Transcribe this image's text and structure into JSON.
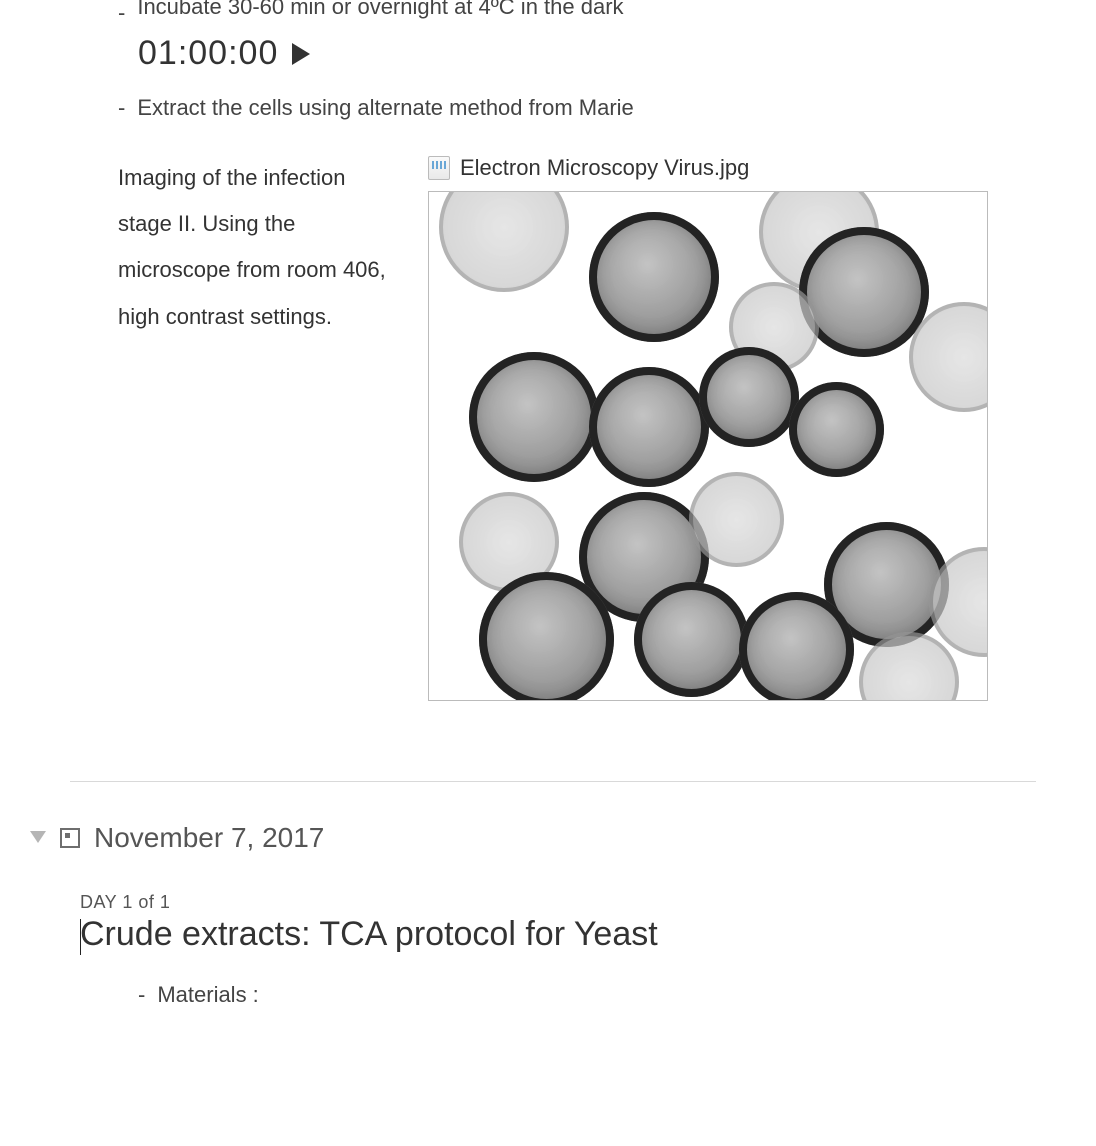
{
  "step_incubate": "Incubate 30-60 min or overnight at 4ºC in the dark",
  "timer": "01:00:00",
  "step_extract": "Extract the cells using alternate method from Marie",
  "caption": "Imaging of the infection stage II. Using the microscope from room 406, high contrast settings.",
  "attachment_filename": "Electron Microscopy Virus.jpg",
  "entry": {
    "date": "November 7, 2017",
    "day_label": "DAY 1 of 1",
    "title": "Crude extracts: TCA protocol for Yeast",
    "first_bullet": "Materials :"
  },
  "dash": "-"
}
